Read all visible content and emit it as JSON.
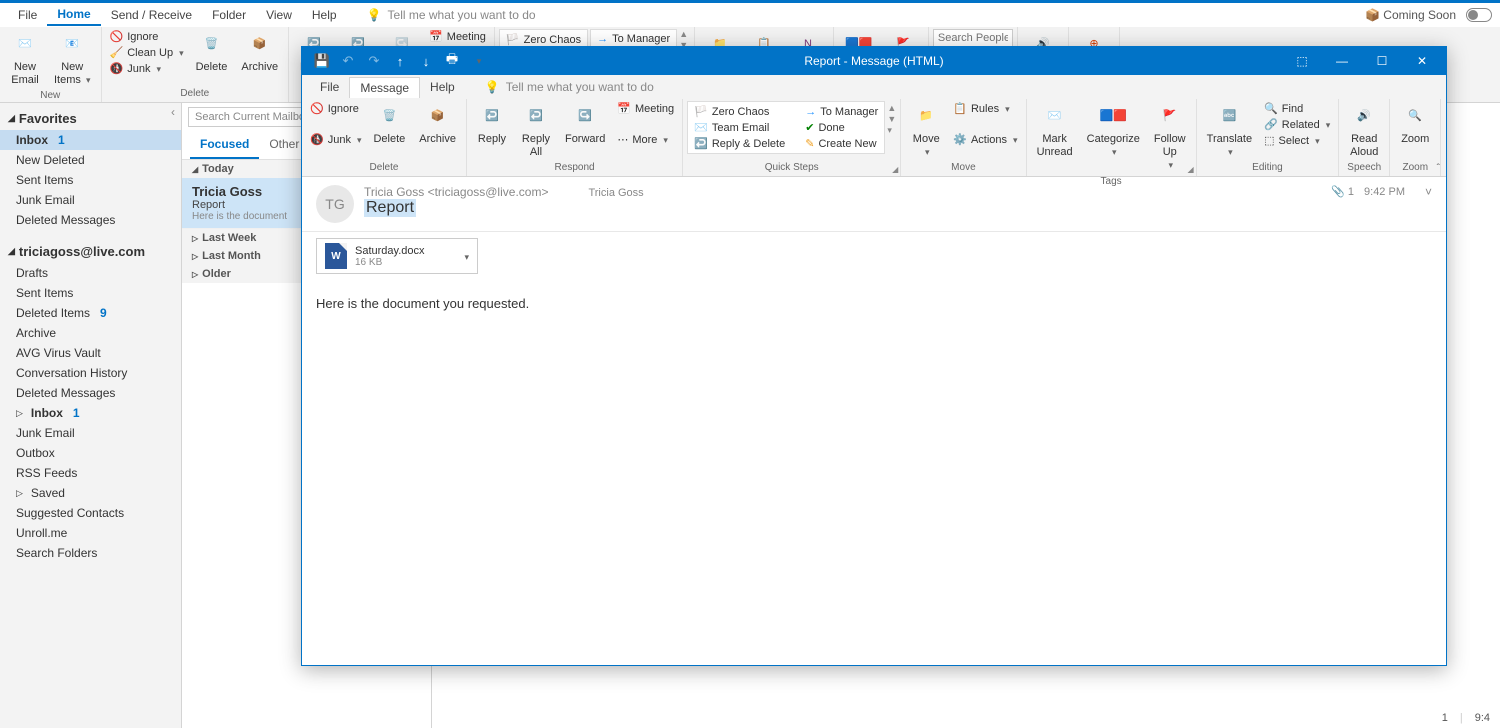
{
  "app": {
    "coming_soon": "Coming Soon"
  },
  "menu": {
    "file": "File",
    "home": "Home",
    "send_receive": "Send / Receive",
    "folder": "Folder",
    "view": "View",
    "help": "Help",
    "tell_me": "Tell me what you want to do"
  },
  "ribbon": {
    "new_email": "New\nEmail",
    "new_items": "New\nItems",
    "new_label": "New",
    "ignore": "Ignore",
    "clean_up": "Clean Up",
    "junk": "Junk",
    "delete": "Delete",
    "archive": "Archive",
    "delete_label": "Delete",
    "reply": "Reply",
    "reply_all": "Reply\nAll",
    "meeting": "Meeting",
    "zero_chaos": "Zero Chaos",
    "to_manager": "To Manager",
    "search_people": "Search People"
  },
  "sidebar": {
    "favorites": "Favorites",
    "inbox": "Inbox",
    "inbox_count": "1",
    "new_deleted": "New Deleted",
    "sent_items": "Sent Items",
    "junk_email": "Junk Email",
    "deleted_messages": "Deleted Messages",
    "account": "triciagoss@live.com",
    "drafts": "Drafts",
    "deleted_items": "Deleted Items",
    "deleted_items_count": "9",
    "archive": "Archive",
    "avg": "AVG Virus Vault",
    "conv_history": "Conversation History",
    "inbox2": "Inbox",
    "inbox2_count": "1",
    "outbox": "Outbox",
    "rss": "RSS Feeds",
    "saved": "Saved",
    "suggested": "Suggested Contacts",
    "unroll": "Unroll.me",
    "search_folders": "Search Folders"
  },
  "msglist": {
    "search_placeholder": "Search Current Mailbo",
    "focused": "Focused",
    "other": "Other",
    "today": "Today",
    "last_week": "Last Week",
    "last_month": "Last Month",
    "older": "Older",
    "item_from": "Tricia Goss",
    "item_subject": "Report",
    "item_preview": "Here is the document"
  },
  "popup": {
    "title": "Report  -  Message (HTML)",
    "tabs": {
      "file": "File",
      "message": "Message",
      "help": "Help",
      "tell_me": "Tell me what you want to do"
    },
    "ribbon": {
      "ignore": "Ignore",
      "junk": "Junk",
      "delete": "Delete",
      "archive": "Archive",
      "delete_label": "Delete",
      "reply": "Reply",
      "reply_all": "Reply\nAll",
      "forward": "Forward",
      "meeting": "Meeting",
      "more": "More",
      "respond_label": "Respond",
      "zero_chaos": "Zero Chaos",
      "to_manager": "To Manager",
      "team_email": "Team Email",
      "done": "Done",
      "reply_delete": "Reply & Delete",
      "create_new": "Create New",
      "quick_steps_label": "Quick Steps",
      "move": "Move",
      "rules": "Rules",
      "actions": "Actions",
      "move_label": "Move",
      "mark_unread": "Mark\nUnread",
      "categorize": "Categorize",
      "follow_up": "Follow\nUp",
      "tags_label": "Tags",
      "translate": "Translate",
      "find": "Find",
      "related": "Related",
      "select": "Select",
      "editing_label": "Editing",
      "read_aloud": "Read\nAloud",
      "speech_label": "Speech",
      "zoom": "Zoom",
      "zoom_label": "Zoom"
    },
    "header": {
      "avatar": "TG",
      "from": "Tricia Goss <triciagoss@live.com>",
      "recipient": "Tricia Goss",
      "subject": "Report",
      "att_count": "1",
      "time": "9:42 PM"
    },
    "attachment": {
      "name": "Saturday.docx",
      "size": "16 KB",
      "badge": "W"
    },
    "body": "Here is the document you requested."
  },
  "status": {
    "count": "1",
    "time": "9:4"
  }
}
